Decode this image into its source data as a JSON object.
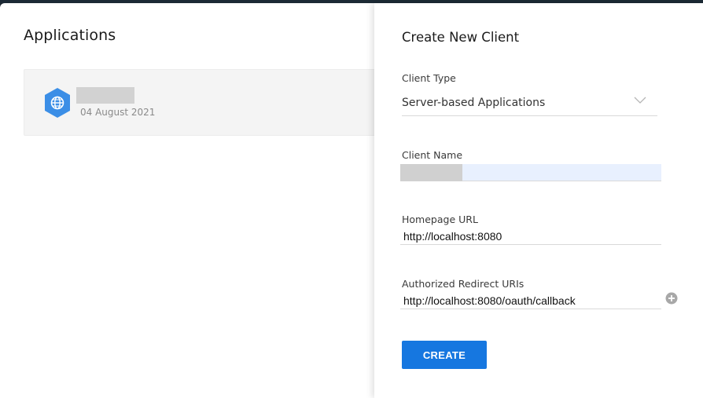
{
  "applications": {
    "title": "Applications",
    "items": [
      {
        "date": "04 August 2021",
        "icon": "globe-icon"
      }
    ]
  },
  "panel": {
    "title": "Create New Client",
    "client_type": {
      "label": "Client Type",
      "value": "Server-based Applications"
    },
    "client_name": {
      "label": "Client Name",
      "value": ""
    },
    "homepage_url": {
      "label": "Homepage URL",
      "value": "http://localhost:8080"
    },
    "redirect_uris": {
      "label": "Authorized Redirect URIs",
      "value": "http://localhost:8080/oauth/callback"
    },
    "create_label": "CREATE"
  },
  "colors": {
    "accent": "#1677e0",
    "icon_blue": "#3b8ee6",
    "autofill_bg": "#e8f0fe"
  }
}
